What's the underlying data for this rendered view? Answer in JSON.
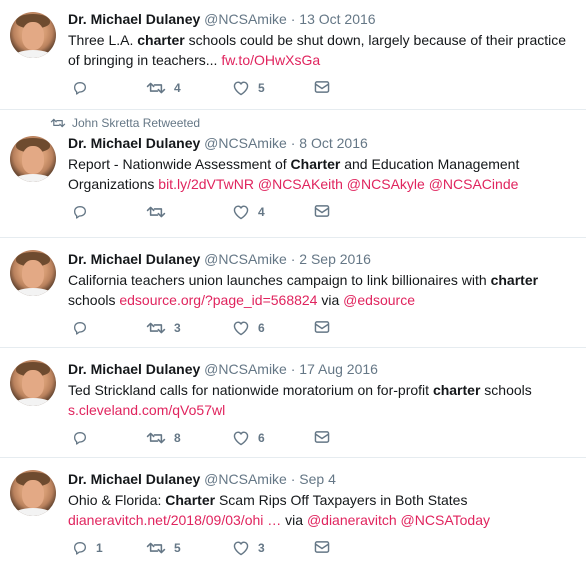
{
  "tweets": [
    {
      "name": "Dr. Michael Dulaney",
      "handle": "@NCSAmike",
      "date": "13 Oct 2016",
      "retweeted_by": "",
      "parts": [
        {
          "t": "text",
          "v": "Three L.A. "
        },
        {
          "t": "bold",
          "v": "charter"
        },
        {
          "t": "text",
          "v": " schools could be shut down, largely because of their practice of bringing in teachers... "
        },
        {
          "t": "link",
          "v": "fw.to/OHwXsGa"
        }
      ],
      "reply_count": "",
      "retweet_count": "4",
      "like_count": "5"
    },
    {
      "name": "Dr. Michael Dulaney",
      "handle": "@NCSAmike",
      "date": "8 Oct 2016",
      "retweeted_by": "John Skretta Retweeted",
      "parts": [
        {
          "t": "text",
          "v": "Report - Nationwide Assessment of "
        },
        {
          "t": "bold",
          "v": "Charter"
        },
        {
          "t": "text",
          "v": " and Education Management Organizations "
        },
        {
          "t": "link",
          "v": "bit.ly/2dVTwNR"
        },
        {
          "t": "text",
          "v": " "
        },
        {
          "t": "link",
          "v": "@NCSAKeith"
        },
        {
          "t": "text",
          "v": " "
        },
        {
          "t": "link",
          "v": "@NCSAkyle"
        },
        {
          "t": "text",
          "v": " "
        },
        {
          "t": "link",
          "v": "@NCSACinde"
        }
      ],
      "reply_count": "",
      "retweet_count": "",
      "like_count": "4"
    },
    {
      "name": "Dr. Michael Dulaney",
      "handle": "@NCSAmike",
      "date": "2 Sep 2016",
      "retweeted_by": "",
      "parts": [
        {
          "t": "text",
          "v": "California teachers union launches campaign to link billionaires with "
        },
        {
          "t": "bold",
          "v": "charter"
        },
        {
          "t": "text",
          "v": " schools "
        },
        {
          "t": "link",
          "v": "edsource.org/?page_id=568824"
        },
        {
          "t": "text",
          "v": " via "
        },
        {
          "t": "link",
          "v": "@edsource"
        }
      ],
      "reply_count": "",
      "retweet_count": "3",
      "like_count": "6"
    },
    {
      "name": "Dr. Michael Dulaney",
      "handle": "@NCSAmike",
      "date": "17 Aug 2016",
      "retweeted_by": "",
      "parts": [
        {
          "t": "text",
          "v": "Ted Strickland calls for nationwide moratorium on for-profit "
        },
        {
          "t": "bold",
          "v": "charter"
        },
        {
          "t": "text",
          "v": " schools "
        },
        {
          "t": "link",
          "v": "s.cleveland.com/qVo57wl"
        }
      ],
      "reply_count": "",
      "retweet_count": "8",
      "like_count": "6"
    },
    {
      "name": "Dr. Michael Dulaney",
      "handle": "@NCSAmike",
      "date": "Sep 4",
      "retweeted_by": "",
      "parts": [
        {
          "t": "text",
          "v": "Ohio & Florida: "
        },
        {
          "t": "bold",
          "v": "Charter"
        },
        {
          "t": "text",
          "v": " Scam Rips Off Taxpayers in Both States "
        },
        {
          "t": "link",
          "v": "dianeravitch.net/2018/09/03/ohi"
        },
        {
          "t": "text",
          "v": " "
        },
        {
          "t": "link",
          "v": "…"
        },
        {
          "t": "text",
          "v": " via "
        },
        {
          "t": "link",
          "v": "@dianeravitch"
        },
        {
          "t": "text",
          "v": " "
        },
        {
          "t": "link",
          "v": "@NCSAToday"
        }
      ],
      "reply_count": "1",
      "retweet_count": "5",
      "like_count": "3"
    }
  ],
  "separator": " · ",
  "colors": {
    "link": "#e0245e",
    "meta": "#657786",
    "text": "#14171a",
    "divider": "#e6ecf0"
  },
  "icons": {
    "reply": "reply-icon",
    "retweet": "retweet-icon",
    "like": "heart-icon",
    "message": "envelope-icon"
  }
}
